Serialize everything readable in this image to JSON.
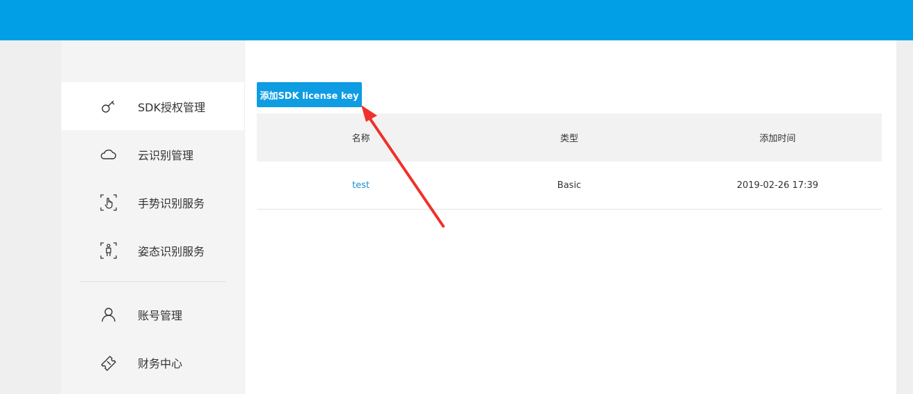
{
  "sidebar": {
    "items": [
      {
        "label": "SDK授权管理",
        "icon": "key-icon"
      },
      {
        "label": "云识别管理",
        "icon": "cloud-icon"
      },
      {
        "label": "手势识别服务",
        "icon": "hand-gesture-icon"
      },
      {
        "label": "姿态识别服务",
        "icon": "body-pose-icon"
      },
      {
        "label": "账号管理",
        "icon": "user-icon"
      },
      {
        "label": "财务中心",
        "icon": "ticket-icon"
      }
    ],
    "active_index": 0
  },
  "main": {
    "add_button_label": "添加SDK license key",
    "table": {
      "columns": [
        "名称",
        "类型",
        "添加时间"
      ],
      "rows": [
        {
          "name": "test",
          "type": "Basic",
          "added": "2019-02-26 17:39"
        }
      ]
    }
  },
  "colors": {
    "topbar": "#009fe6",
    "button": "#0e9ce3",
    "link": "#1c8fd0",
    "annotation_arrow": "#f0302a"
  }
}
